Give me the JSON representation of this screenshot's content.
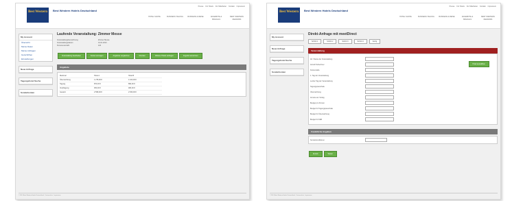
{
  "left": {
    "brand": "Best Western Hotels Deutschland",
    "logo": "Best Western",
    "topnav": [
      "Presse",
      "Für Hotels",
      "Für Mitarbeiter",
      "Kontakt",
      "Impressum"
    ],
    "mainnav": [
      "HOTEL SUCHE",
      "BUSINESS TAGUNG",
      "BUSINESS & REISE",
      "ANGEBOTE & SPECIALS",
      "BEST WESTERN REWARDS"
    ],
    "sidebar": [
      {
        "title": "My Account",
        "items": [
          "Übersicht",
          "Meine Daten",
          "Meine Anfragen",
          "Gutschriften",
          "Einstellungen"
        ]
      },
      {
        "title": "Neue Anfrage",
        "items": []
      },
      {
        "title": "Tagungshotel Suche",
        "items": []
      },
      {
        "title": "Sonderkonten",
        "items": []
      }
    ],
    "title": "Laufende Veranstaltung: Zimmer Messe",
    "fields": [
      [
        "Veranstaltungsbezeichnung",
        "Zimmer Messe"
      ],
      [
        "Veranstaltungsdatum",
        "01.01.2013"
      ],
      [
        "Personenanzahl",
        "120"
      ]
    ],
    "buttons": [
      "Veranstaltung bearbeiten",
      "Kosten anzeigen",
      "Angebote vergleichen",
      "Drucken",
      "Weitere Hotels anfragen",
      "Angebot annehmen"
    ],
    "section": "Angebote",
    "table_headers": [
      "Merkmal",
      "Hotel A",
      "Hotel B"
    ],
    "table_rows": [
      [
        "Übernachtung",
        "1.278,00 €",
        "1.160,00 €"
      ],
      [
        "Tagung",
        "870,00 €",
        "890,00 €"
      ],
      [
        "Verpflegung",
        "450,00 €",
        "480,00 €"
      ],
      [
        "Gesamt",
        "2.598,00 €",
        "2.530,00 €"
      ]
    ],
    "footer": "© 2013 Best Western Hotels Deutschland · Datenschutz · Impressum"
  },
  "right": {
    "brand": "Best Western Hotels Deutschland",
    "logo": "Best Western",
    "topnav": [
      "Presse",
      "Für Hotels",
      "Für Mitarbeiter",
      "Kontakt",
      "Impressum"
    ],
    "mainnav": [
      "HOTEL SUCHE",
      "BUSINESS TAGUNG",
      "BUSINESS & REISE",
      "ANGEBOTE & SPECIALS",
      "BEST WESTERN REWARDS"
    ],
    "sidebar": [
      {
        "title": "My Account",
        "items": []
      },
      {
        "title": "Neue Anfrage",
        "items": []
      },
      {
        "title": "Tagungshotel Suche",
        "items": []
      },
      {
        "title": "Sonderkonten",
        "items": []
      }
    ],
    "title": "Direkt-Anfrage mit meetDirect",
    "steps": [
      "Schritt 1",
      "Schritt 2",
      "Schritt 3",
      "Schritt 4",
      "Fertig"
    ],
    "section": "Veranstaltung",
    "form": [
      "Art / Name der Veranstaltung",
      "Anzahl Teilnehmer",
      "Kostenstelle",
      "1. Tag der Veranstaltung",
      "Letzter Tag der Veranstaltung",
      "Tagungspauschale",
      "Übernachtung",
      "Anreise am Vortag",
      "Budget pro Person",
      "Budget für Tagungspauschale",
      "Budget für Übernachtung",
      "Budget für F&B"
    ],
    "action_button": "Hotel auswählen",
    "section2": "Zusätzliche Angaben",
    "select_label": "Sonderkonditionen",
    "buttons": [
      "Zurück",
      "Weiter"
    ],
    "footer": "© 2013 Best Western Hotels Deutschland · Datenschutz · Impressum"
  }
}
